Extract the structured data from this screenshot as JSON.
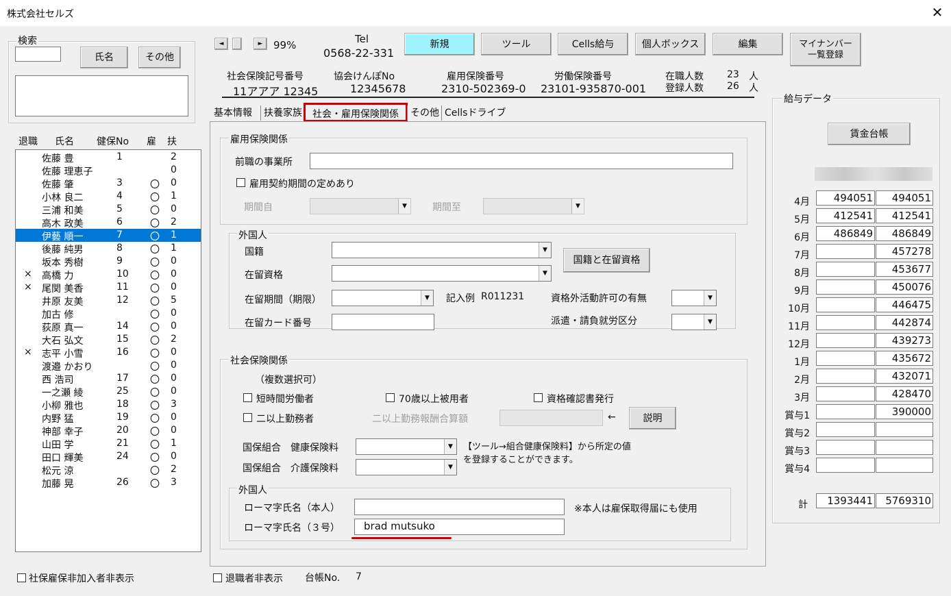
{
  "window": {
    "title": "株式会社セルズ",
    "close_glyph": "✕"
  },
  "search": {
    "group_label": "検索",
    "name_button": "氏名",
    "other_button": "その他",
    "input_value": "",
    "results": ""
  },
  "list_headers": {
    "retired": "退職",
    "name": "氏名",
    "kenpo_no": "健保No",
    "koyo": "雇",
    "fuyo": "扶"
  },
  "employees": [
    {
      "retired": "",
      "name": "佐藤 豊",
      "no": "1",
      "koyo": "",
      "fuyo": "2"
    },
    {
      "retired": "",
      "name": "佐藤 理恵子",
      "no": "",
      "koyo": "",
      "fuyo": "0"
    },
    {
      "retired": "",
      "name": "佐藤 肇",
      "no": "3",
      "koyo": "〇",
      "fuyo": "0"
    },
    {
      "retired": "",
      "name": "小林 良二",
      "no": "4",
      "koyo": "〇",
      "fuyo": "1"
    },
    {
      "retired": "",
      "name": "三浦 和美",
      "no": "5",
      "koyo": "〇",
      "fuyo": "0"
    },
    {
      "retired": "",
      "name": "高木 政美",
      "no": "6",
      "koyo": "〇",
      "fuyo": "2"
    },
    {
      "retired": "",
      "name": "伊藝 順一",
      "no": "7",
      "koyo": "〇",
      "fuyo": "1"
    },
    {
      "retired": "",
      "name": "後藤 純男",
      "no": "8",
      "koyo": "〇",
      "fuyo": "1"
    },
    {
      "retired": "",
      "name": "坂本 秀樹",
      "no": "9",
      "koyo": "〇",
      "fuyo": "0"
    },
    {
      "retired": "×",
      "name": "高橋 力",
      "no": "10",
      "koyo": "〇",
      "fuyo": "0"
    },
    {
      "retired": "×",
      "name": "尾関 美香",
      "no": "11",
      "koyo": "〇",
      "fuyo": "0"
    },
    {
      "retired": "",
      "name": "井原 友美",
      "no": "12",
      "koyo": "〇",
      "fuyo": "5"
    },
    {
      "retired": "",
      "name": "加古 修",
      "no": "",
      "koyo": "〇",
      "fuyo": "0"
    },
    {
      "retired": "",
      "name": "荻原 真一",
      "no": "14",
      "koyo": "〇",
      "fuyo": "0"
    },
    {
      "retired": "",
      "name": "大石 弘文",
      "no": "15",
      "koyo": "〇",
      "fuyo": "2"
    },
    {
      "retired": "×",
      "name": "志平 小雪",
      "no": "16",
      "koyo": "〇",
      "fuyo": "0"
    },
    {
      "retired": "",
      "name": "渡邉 かおり",
      "no": "",
      "koyo": "〇",
      "fuyo": "0"
    },
    {
      "retired": "",
      "name": "西 浩司",
      "no": "17",
      "koyo": "〇",
      "fuyo": "0"
    },
    {
      "retired": "",
      "name": "一之瀬 綾",
      "no": "25",
      "koyo": "〇",
      "fuyo": "0"
    },
    {
      "retired": "",
      "name": "小柳 雅也",
      "no": "18",
      "koyo": "〇",
      "fuyo": "3"
    },
    {
      "retired": "",
      "name": "内野 猛",
      "no": "19",
      "koyo": "〇",
      "fuyo": "0"
    },
    {
      "retired": "",
      "name": "神部 幸子",
      "no": "20",
      "koyo": "〇",
      "fuyo": "0"
    },
    {
      "retired": "",
      "name": "山田 学",
      "no": "21",
      "koyo": "〇",
      "fuyo": "1"
    },
    {
      "retired": "",
      "name": "田口 輝美",
      "no": "24",
      "koyo": "〇",
      "fuyo": "0"
    },
    {
      "retired": "",
      "name": "松元 涼",
      "no": "",
      "koyo": "〇",
      "fuyo": "2"
    },
    {
      "retired": "",
      "name": "加藤 晃",
      "no": "26",
      "koyo": "〇",
      "fuyo": "3"
    }
  ],
  "selected_employee_index": 6,
  "bottom": {
    "hide_unenrolled": "社保雇保非加入者非表示",
    "hide_retired": "退職者非表示",
    "ledger_label": "台帳No.",
    "ledger_no": "7"
  },
  "nav": {
    "prev": "◄",
    "next": "►",
    "zoom": "99%"
  },
  "tel": {
    "label": "Tel",
    "number": "0568-22-331"
  },
  "toolbar": {
    "new": "新規",
    "tools": "ツール",
    "cells_kyuyo": "Cells給与",
    "personal_box": "個人ボックス",
    "edit": "編集",
    "mynumber_l1": "マイナンバー",
    "mynumber_l2": "一覧登録"
  },
  "insurance_header": {
    "shaho_label": "社会保険記号番号",
    "shaho_value": "11アアア 12345",
    "kyokai_label": "協会けんぽNo",
    "kyokai_value": "12345678",
    "koyo_label": "雇用保険番号",
    "koyo_value": "2310-502369-0",
    "rodo_label": "労働保険番号",
    "rodo_value": "23101-935870-001",
    "zaishoku_label": "在職人数",
    "zaishoku_value": "23",
    "toroku_label": "登録人数",
    "toroku_value": "26",
    "unit": "人"
  },
  "tabs": [
    "基本情報",
    "扶養家族",
    "社会・雇用保険関係",
    "その他",
    "Cellsドライブ"
  ],
  "active_tab": 2,
  "koyo_section": {
    "label": "雇用保険関係",
    "prev_employer_label": "前職の事業所",
    "prev_employer_value": "",
    "contract_period_label": "雇用契約期間の定めあり",
    "period_from_label": "期間自",
    "period_to_label": "期間至"
  },
  "foreigner_section": {
    "label": "外国人",
    "nationality_label": "国籍",
    "status_label": "在留資格",
    "period_label": "在留期間（期限）",
    "example_label": "記入例",
    "example_value": "R011231",
    "work_permit_label": "資格外活動許可の有無",
    "card_label": "在留カード番号",
    "dispatch_label": "派遣・請負就労区分",
    "nat_status_button": "国籍と在留資格"
  },
  "shaho_section": {
    "label": "社会保険関係",
    "multi_select": "（複数選択可）",
    "short_time": "短時間労働者",
    "over70": "70歳以上被用者",
    "cert_issue": "資格確認書発行",
    "multi_work": "二以上勤務者",
    "multi_work_total": "二以上勤務報酬合算額",
    "arrow": "←",
    "explain_button": "説明",
    "kokuho_label": "国保組合",
    "health_fee": "健康保険料",
    "care_fee": "介護保険料",
    "note_l1": "【ツール→組合健康保険料】から所定の値",
    "note_l2": "を登録することができます。"
  },
  "romaji_section": {
    "label": "外国人",
    "self_label": "ローマ字氏名（本人）",
    "self_value": "",
    "self_note": "※本人は雇保取得届にも使用",
    "no3_label": "ローマ字氏名（３号）",
    "no3_value": "brad mutsuko"
  },
  "salary": {
    "group_label": "給与データ",
    "ledger_button": "賃金台帳",
    "months": [
      "4月",
      "5月",
      "6月",
      "7月",
      "8月",
      "9月",
      "10月",
      "11月",
      "12月",
      "1月",
      "2月",
      "3月",
      "賞与1",
      "賞与2",
      "賞与3",
      "賞与4"
    ],
    "col1": [
      "494051",
      "412541",
      "486849",
      "",
      "",
      "",
      "",
      "",
      "",
      "",
      "",
      "",
      "",
      "",
      "",
      ""
    ],
    "col2": [
      "494051",
      "412541",
      "486849",
      "457278",
      "453677",
      "450076",
      "446475",
      "442874",
      "439273",
      "435672",
      "432071",
      "428470",
      "390000",
      "",
      "",
      ""
    ],
    "total_label": "計",
    "total1": "1393441",
    "total2": "5769310"
  },
  "accent_colors": {
    "selection": "#0078d7",
    "highlight": "#d00000",
    "new_button": "#9ff3ff"
  }
}
